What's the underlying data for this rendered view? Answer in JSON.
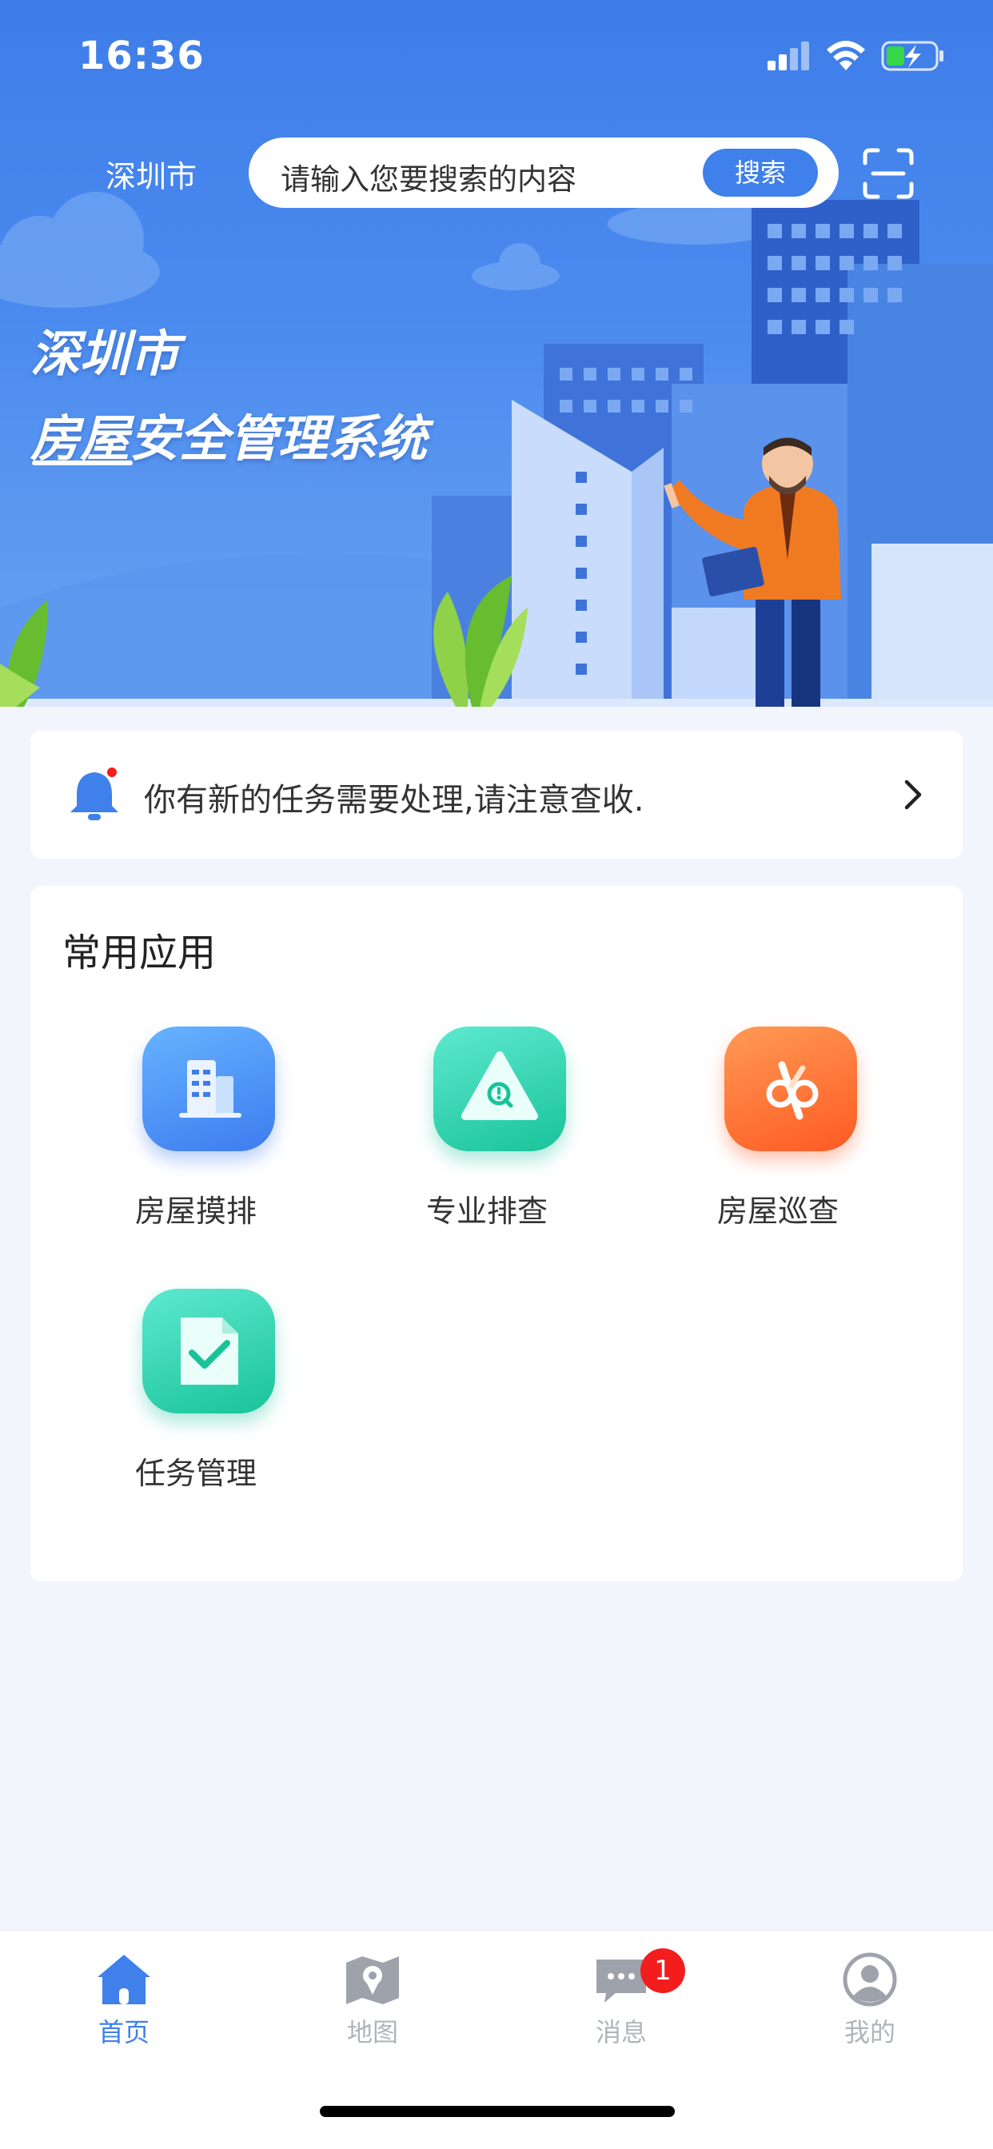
{
  "status_bar": {
    "time": "16:36"
  },
  "header": {
    "city": "深圳市",
    "search_placeholder": "请输入您要搜索的内容",
    "search_button": "搜索"
  },
  "banner": {
    "title_line1": "深圳市",
    "title_line2": "房屋安全管理系统"
  },
  "notice": {
    "text": "你有新的任务需要处理,请注意查收."
  },
  "apps": {
    "title": "常用应用",
    "items": [
      {
        "label": "房屋摸排",
        "icon": "building-icon"
      },
      {
        "label": "专业排查",
        "icon": "warning-search-icon"
      },
      {
        "label": "房屋巡查",
        "icon": "patrol-icon"
      },
      {
        "label": "任务管理",
        "icon": "task-check-icon"
      }
    ]
  },
  "tabbar": {
    "items": [
      {
        "label": "首页",
        "icon": "home-icon",
        "active": true
      },
      {
        "label": "地图",
        "icon": "map-icon",
        "active": false
      },
      {
        "label": "消息",
        "icon": "message-icon",
        "active": false,
        "badge": "1"
      },
      {
        "label": "我的",
        "icon": "profile-icon",
        "active": false
      }
    ]
  },
  "colors": {
    "accent": "#3f80ea",
    "badge": "#f31d1d",
    "inactive_tab": "#b0b4bb"
  }
}
